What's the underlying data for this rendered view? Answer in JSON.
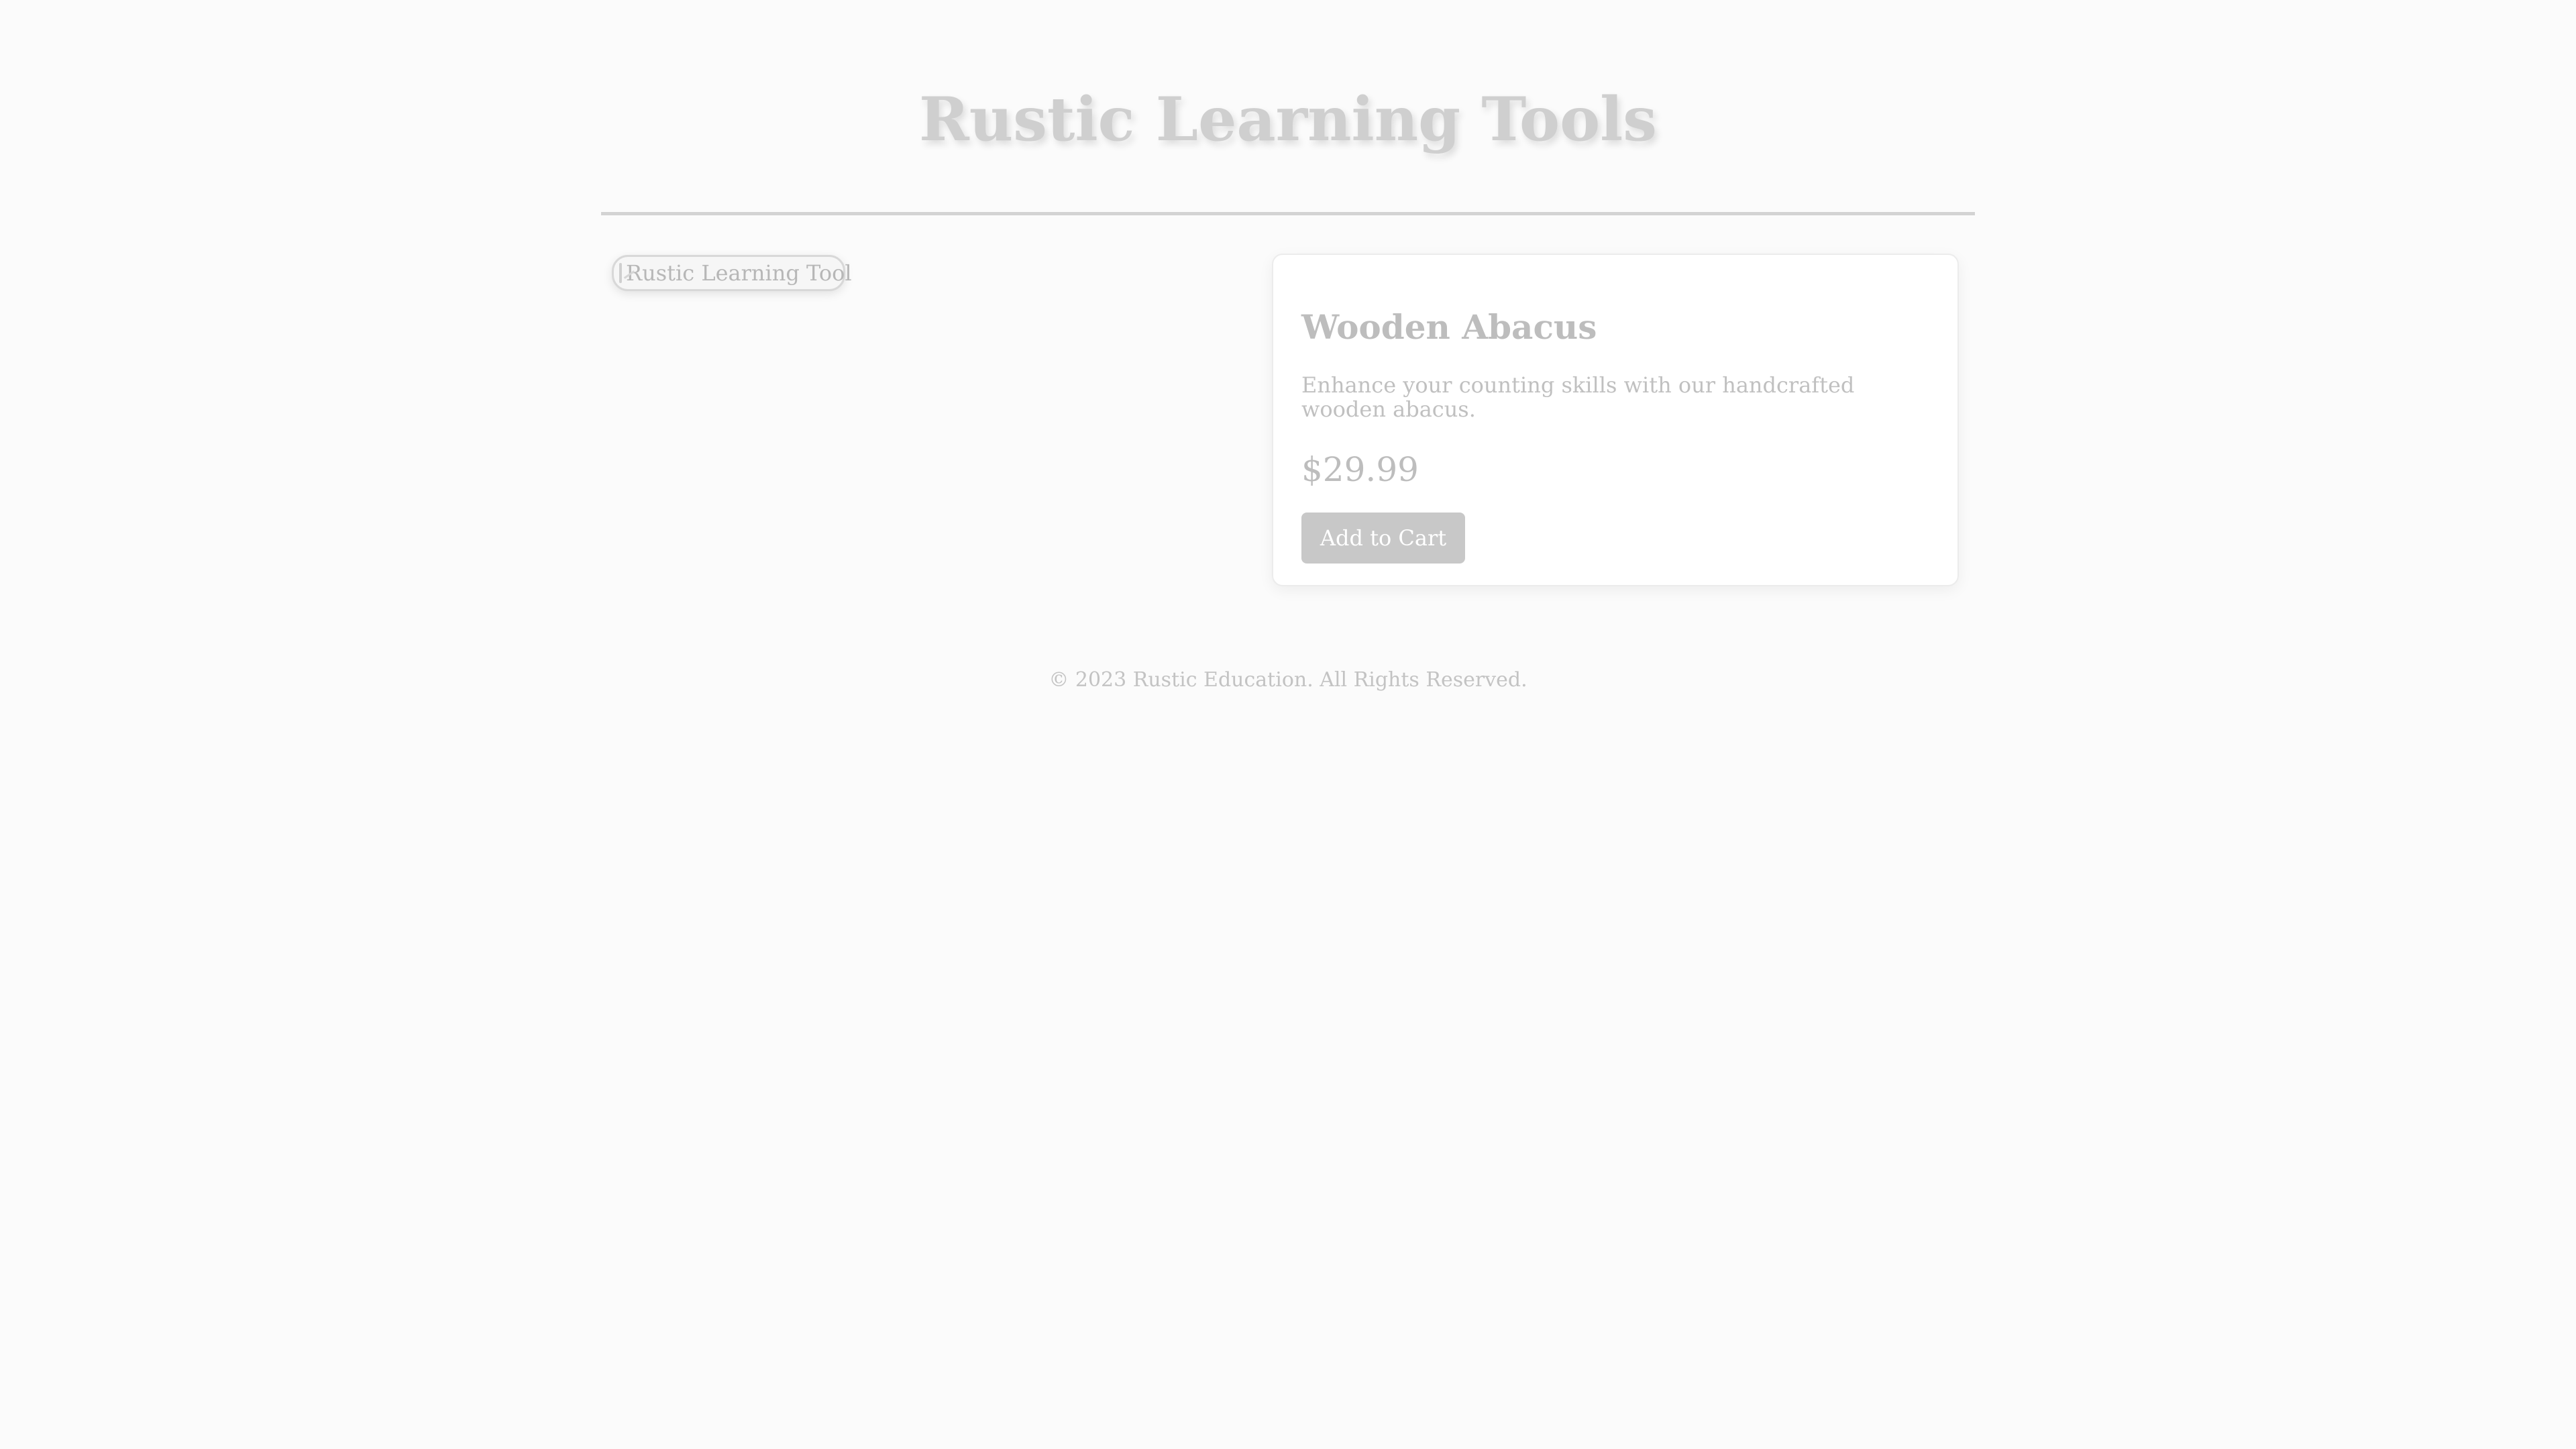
{
  "header": {
    "title": "Rustic Learning Tools"
  },
  "product": {
    "image_alt": "Rustic Learning Tool",
    "name": "Wooden Abacus",
    "description": "Enhance your counting skills with our handcrafted wooden abacus.",
    "price": "$29.99",
    "add_to_cart_label": "Add to Cart"
  },
  "footer": {
    "text": "© 2023 Rustic Education. All Rights Reserved."
  },
  "icons": {
    "image_placeholder": "broken-image-icon"
  },
  "colors": {
    "background": "#fbfbfb",
    "title": "#cfcfcf",
    "button": "#c8c8c8"
  }
}
